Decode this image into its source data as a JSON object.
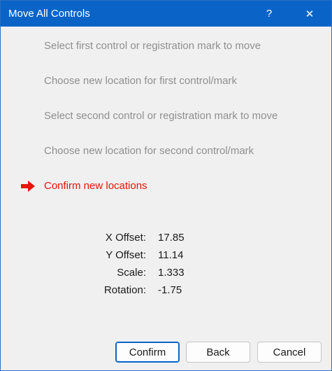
{
  "window": {
    "title": "Move All Controls",
    "help_icon": "?",
    "close_icon": "✕"
  },
  "steps": [
    {
      "label": "Select first control or registration mark to move",
      "state": "done"
    },
    {
      "label": "Choose new location for first control/mark",
      "state": "done"
    },
    {
      "label": "Select second control or registration mark to move",
      "state": "done"
    },
    {
      "label": "Choose new location for second control/mark",
      "state": "done"
    },
    {
      "label": "Confirm new locations",
      "state": "current",
      "indicator": "red-arrow-icon"
    }
  ],
  "stats": {
    "x_offset_label": "X Offset:",
    "x_offset_value": "17.85",
    "y_offset_label": "Y Offset:",
    "y_offset_value": "11.14",
    "scale_label": "Scale:",
    "scale_value": "1.333",
    "rotation_label": "Rotation:",
    "rotation_value": "-1.75"
  },
  "buttons": {
    "confirm": "Confirm",
    "back": "Back",
    "cancel": "Cancel"
  },
  "colors": {
    "titlebar": "#0a64c8",
    "active_step": "#e8140a",
    "inactive_step": "#8f8f8f"
  }
}
